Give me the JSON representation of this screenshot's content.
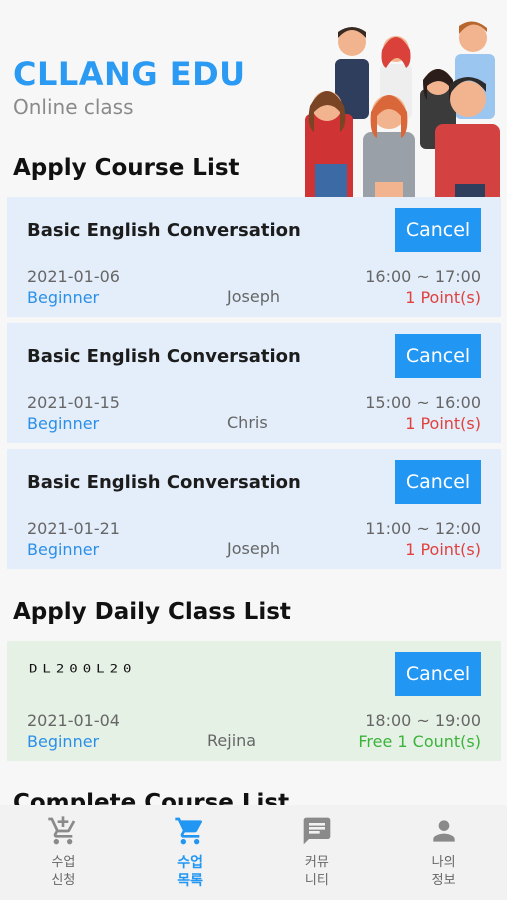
{
  "app": {
    "brand_title": "CLLANG EDU",
    "brand_subtitle": "Online class"
  },
  "sections": {
    "apply_course": "Apply Course List",
    "apply_daily": "Apply Daily Class List",
    "complete_course": "Complete Course List"
  },
  "courses": [
    {
      "title": "Basic English Conversation",
      "cancel": "Cancel",
      "date": "2021-01-06",
      "time": "16:00 ~ 17:00",
      "level": "Beginner",
      "teacher": "Joseph",
      "points": "1 Point(s)"
    },
    {
      "title": "Basic English Conversation",
      "cancel": "Cancel",
      "date": "2021-01-15",
      "time": "15:00 ~ 16:00",
      "level": "Beginner",
      "teacher": "Chris",
      "points": "1 Point(s)"
    },
    {
      "title": "Basic English Conversation",
      "cancel": "Cancel",
      "date": "2021-01-21",
      "time": "11:00 ~ 12:00",
      "level": "Beginner",
      "teacher": "Joseph",
      "points": "1 Point(s)"
    }
  ],
  "daily": [
    {
      "code": "DL200L20",
      "cancel": "Cancel",
      "date": "2021-01-04",
      "time": "18:00 ~ 19:00",
      "level": "Beginner",
      "teacher": "Rejina",
      "points": "Free 1 Count(s)"
    }
  ],
  "tabs": [
    {
      "label": "수업\n신청",
      "icon": "add-shopping-cart-icon",
      "active": false
    },
    {
      "label": "수업\n목록",
      "icon": "shopping-cart-icon",
      "active": true
    },
    {
      "label": "커뮤\n니티",
      "icon": "chat-icon",
      "active": false
    },
    {
      "label": "나의\n정보",
      "icon": "person-icon",
      "active": false
    }
  ],
  "colors": {
    "accent": "#2196f3",
    "brand": "#2b9af3",
    "course_card": "#e4eefa",
    "daily_card": "#e6f1e6",
    "points_red": "#e0413d",
    "free_green": "#3bb33b"
  }
}
